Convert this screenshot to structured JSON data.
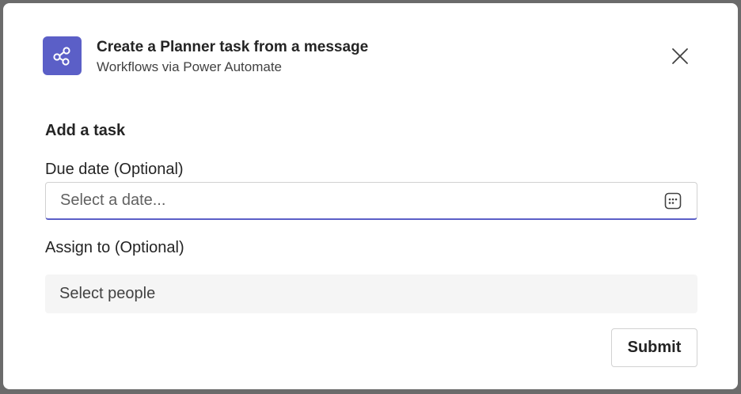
{
  "header": {
    "title": "Create a Planner task from a message",
    "subtitle": "Workflows via Power Automate",
    "icon": "share-nodes-icon",
    "icon_bg": "#5b5fc7"
  },
  "form": {
    "heading": "Add a task",
    "due_date": {
      "label": "Due date (Optional)",
      "placeholder": "Select a date...",
      "value": "",
      "icon": "calendar-icon"
    },
    "assign_to": {
      "label": "Assign to (Optional)",
      "placeholder": "Select people"
    },
    "submit_label": "Submit"
  },
  "colors": {
    "accent": "#5b5fc7",
    "text_primary": "#242424",
    "field_bg": "#f5f5f5"
  }
}
